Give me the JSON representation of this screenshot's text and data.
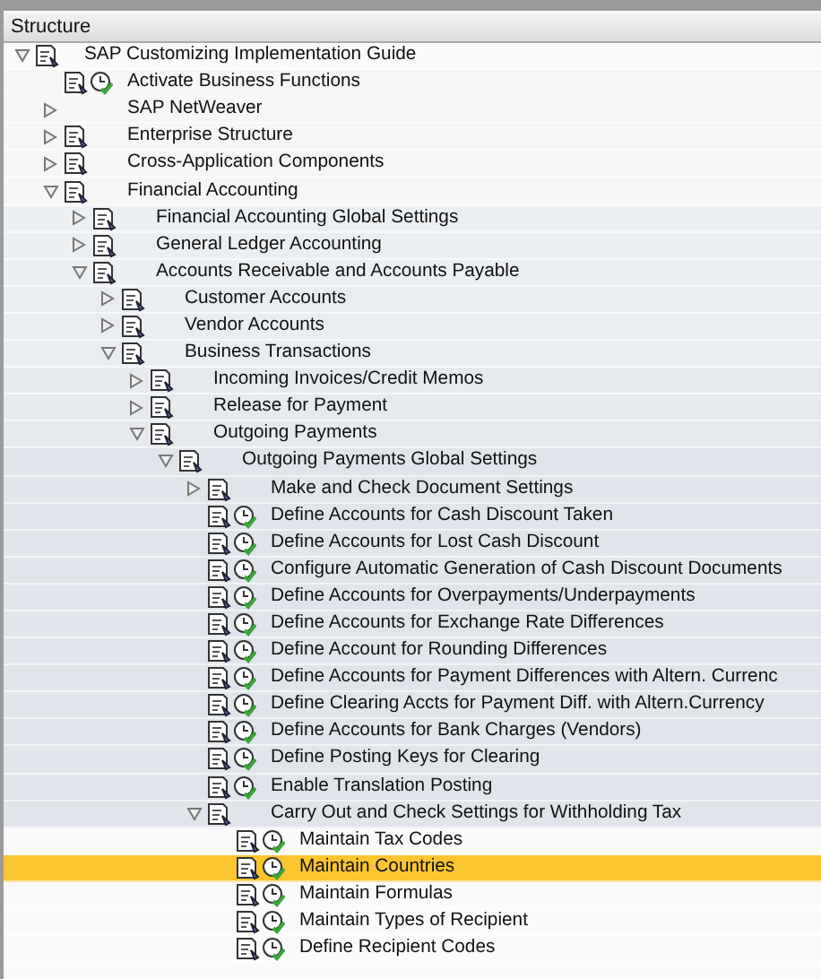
{
  "panel": {
    "header": "Structure"
  },
  "tree": [
    {
      "label": "SAP Customizing Implementation Guide",
      "kind": "folder",
      "expanded": true,
      "selected": false,
      "children": [
        {
          "label": "Activate Business Functions",
          "kind": "activity",
          "selected": false
        },
        {
          "label": "SAP NetWeaver",
          "kind": "plain",
          "expanded": false,
          "selected": false
        },
        {
          "label": "Enterprise Structure",
          "kind": "folder",
          "expanded": false,
          "selected": false
        },
        {
          "label": "Cross-Application Components",
          "kind": "folder",
          "expanded": false,
          "selected": false
        },
        {
          "label": "Financial Accounting",
          "kind": "folder",
          "expanded": true,
          "selected": false,
          "children": [
            {
              "label": "Financial Accounting Global Settings",
              "kind": "folder",
              "expanded": false,
              "selected": false
            },
            {
              "label": "General Ledger Accounting",
              "kind": "folder",
              "expanded": false,
              "selected": false
            },
            {
              "label": "Accounts Receivable and Accounts Payable",
              "kind": "folder",
              "expanded": true,
              "selected": false,
              "children": [
                {
                  "label": "Customer Accounts",
                  "kind": "folder",
                  "expanded": false,
                  "selected": false
                },
                {
                  "label": "Vendor Accounts",
                  "kind": "folder",
                  "expanded": false,
                  "selected": false
                },
                {
                  "label": "Business Transactions",
                  "kind": "folder",
                  "expanded": true,
                  "selected": false,
                  "children": [
                    {
                      "label": "Incoming Invoices/Credit Memos",
                      "kind": "folder",
                      "expanded": false,
                      "selected": false
                    },
                    {
                      "label": "Release for Payment",
                      "kind": "folder",
                      "expanded": false,
                      "selected": false
                    },
                    {
                      "label": "Outgoing Payments",
                      "kind": "folder",
                      "expanded": true,
                      "selected": false,
                      "children": [
                        {
                          "label": "Outgoing Payments Global Settings",
                          "kind": "folder",
                          "expanded": true,
                          "selected": false,
                          "children": [
                            {
                              "label": "Make and Check Document Settings",
                              "kind": "folder",
                              "expanded": false,
                              "selected": false
                            },
                            {
                              "label": "Define Accounts for Cash Discount Taken",
                              "kind": "activity",
                              "selected": false
                            },
                            {
                              "label": "Define Accounts for Lost Cash Discount",
                              "kind": "activity",
                              "selected": false
                            },
                            {
                              "label": "Configure Automatic Generation of Cash Discount Documents",
                              "kind": "activity",
                              "selected": false
                            },
                            {
                              "label": "Define Accounts for Overpayments/Underpayments",
                              "kind": "activity",
                              "selected": false
                            },
                            {
                              "label": "Define Accounts for Exchange Rate Differences",
                              "kind": "activity",
                              "selected": false
                            },
                            {
                              "label": "Define Account for Rounding Differences",
                              "kind": "activity",
                              "selected": false
                            },
                            {
                              "label": "Define Accounts for Payment Differences with Altern. Currenc",
                              "kind": "activity",
                              "selected": false
                            },
                            {
                              "label": "Define Clearing Accts for Payment Diff. with Altern.Currency",
                              "kind": "activity",
                              "selected": false
                            },
                            {
                              "label": "Define Accounts for Bank Charges (Vendors)",
                              "kind": "activity",
                              "selected": false
                            },
                            {
                              "label": "Define Posting Keys for Clearing",
                              "kind": "activity",
                              "selected": false
                            },
                            {
                              "label": "Enable Translation Posting",
                              "kind": "activity",
                              "selected": false
                            },
                            {
                              "label": "Carry Out and Check Settings for Withholding Tax",
                              "kind": "folder",
                              "expanded": true,
                              "selected": false,
                              "children": [
                                {
                                  "label": "Maintain Tax Codes",
                                  "kind": "activity",
                                  "selected": false
                                },
                                {
                                  "label": "Maintain Countries",
                                  "kind": "activity",
                                  "selected": true
                                },
                                {
                                  "label": "Maintain Formulas",
                                  "kind": "activity",
                                  "selected": false
                                },
                                {
                                  "label": "Maintain Types of Recipient",
                                  "kind": "activity",
                                  "selected": false
                                },
                                {
                                  "label": "Define Recipient Codes",
                                  "kind": "activity",
                                  "selected": false
                                }
                              ]
                            }
                          ]
                        }
                      ]
                    }
                  ]
                }
              ]
            }
          ]
        }
      ]
    }
  ]
}
